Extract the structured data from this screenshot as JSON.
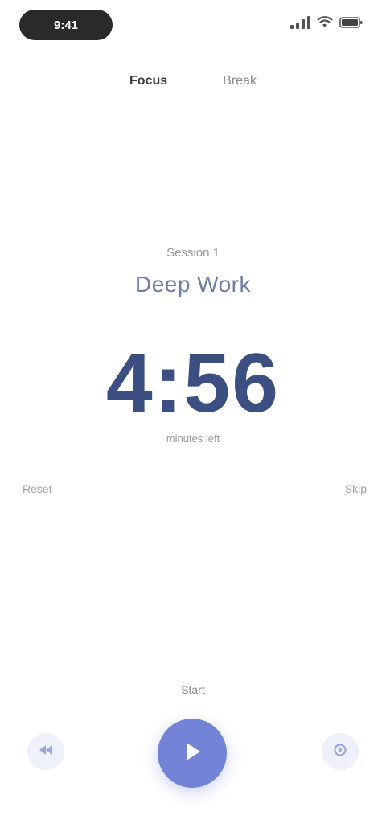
{
  "status_bar": {
    "time": "9:41"
  },
  "tabs": [
    {
      "label": "Focus",
      "active": true
    },
    {
      "label": "Break",
      "active": false
    }
  ],
  "timer": {
    "caption": "Session 1",
    "title": "Deep Work",
    "value": "4:56",
    "unit": "minutes left"
  },
  "side_labels": {
    "left": "Reset",
    "right": "Skip"
  },
  "controls": {
    "caption": "Start",
    "left_icon": "rewind-icon",
    "main_icon": "play-icon",
    "right_icon": "settings-icon"
  },
  "colors": {
    "accent": "#7383d6",
    "timer_text": "#3b4f82",
    "title_text": "#6c7da6"
  }
}
